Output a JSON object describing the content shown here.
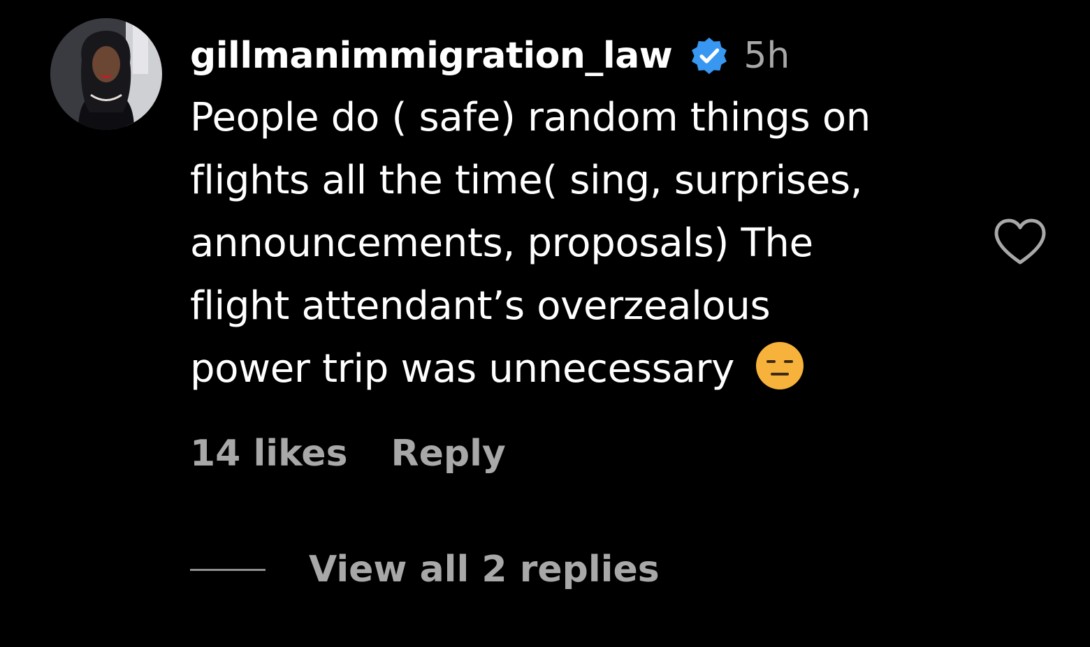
{
  "comment": {
    "username": "gillmanimmigration_law",
    "verified": true,
    "timestamp": "5h",
    "text_lines": [
      "People do ( safe) random things on",
      "flights all the time( sing, surprises,",
      "announcements, proposals) The",
      "flight attendant’s overzealous",
      "power trip was unnecessary"
    ],
    "emoji": "😑",
    "likes": "14 likes",
    "reply_label": "Reply",
    "view_replies_label": "View all 2 replies"
  },
  "icons": {
    "verified": "verified-badge-icon",
    "like": "heart-outline-icon",
    "emoji": "expressionless-face-emoji"
  },
  "colors": {
    "background": "#000000",
    "text": "#ffffff",
    "muted": "#a8a8a8",
    "verified_blue": "#3897f0",
    "emoji_yellow": "#f6b23b"
  }
}
